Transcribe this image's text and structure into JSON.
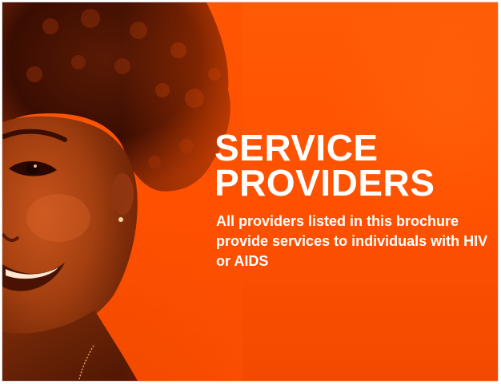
{
  "brochure": {
    "title_line1": "SERVICE",
    "title_line2": "PROVIDERS",
    "subtitle": "All providers listed in this brochure provide services to individuals with HIV or AIDS"
  },
  "colors": {
    "background": "#ff5000",
    "text": "#ffffff"
  },
  "image": {
    "subject": "smiling-woman-portrait"
  }
}
